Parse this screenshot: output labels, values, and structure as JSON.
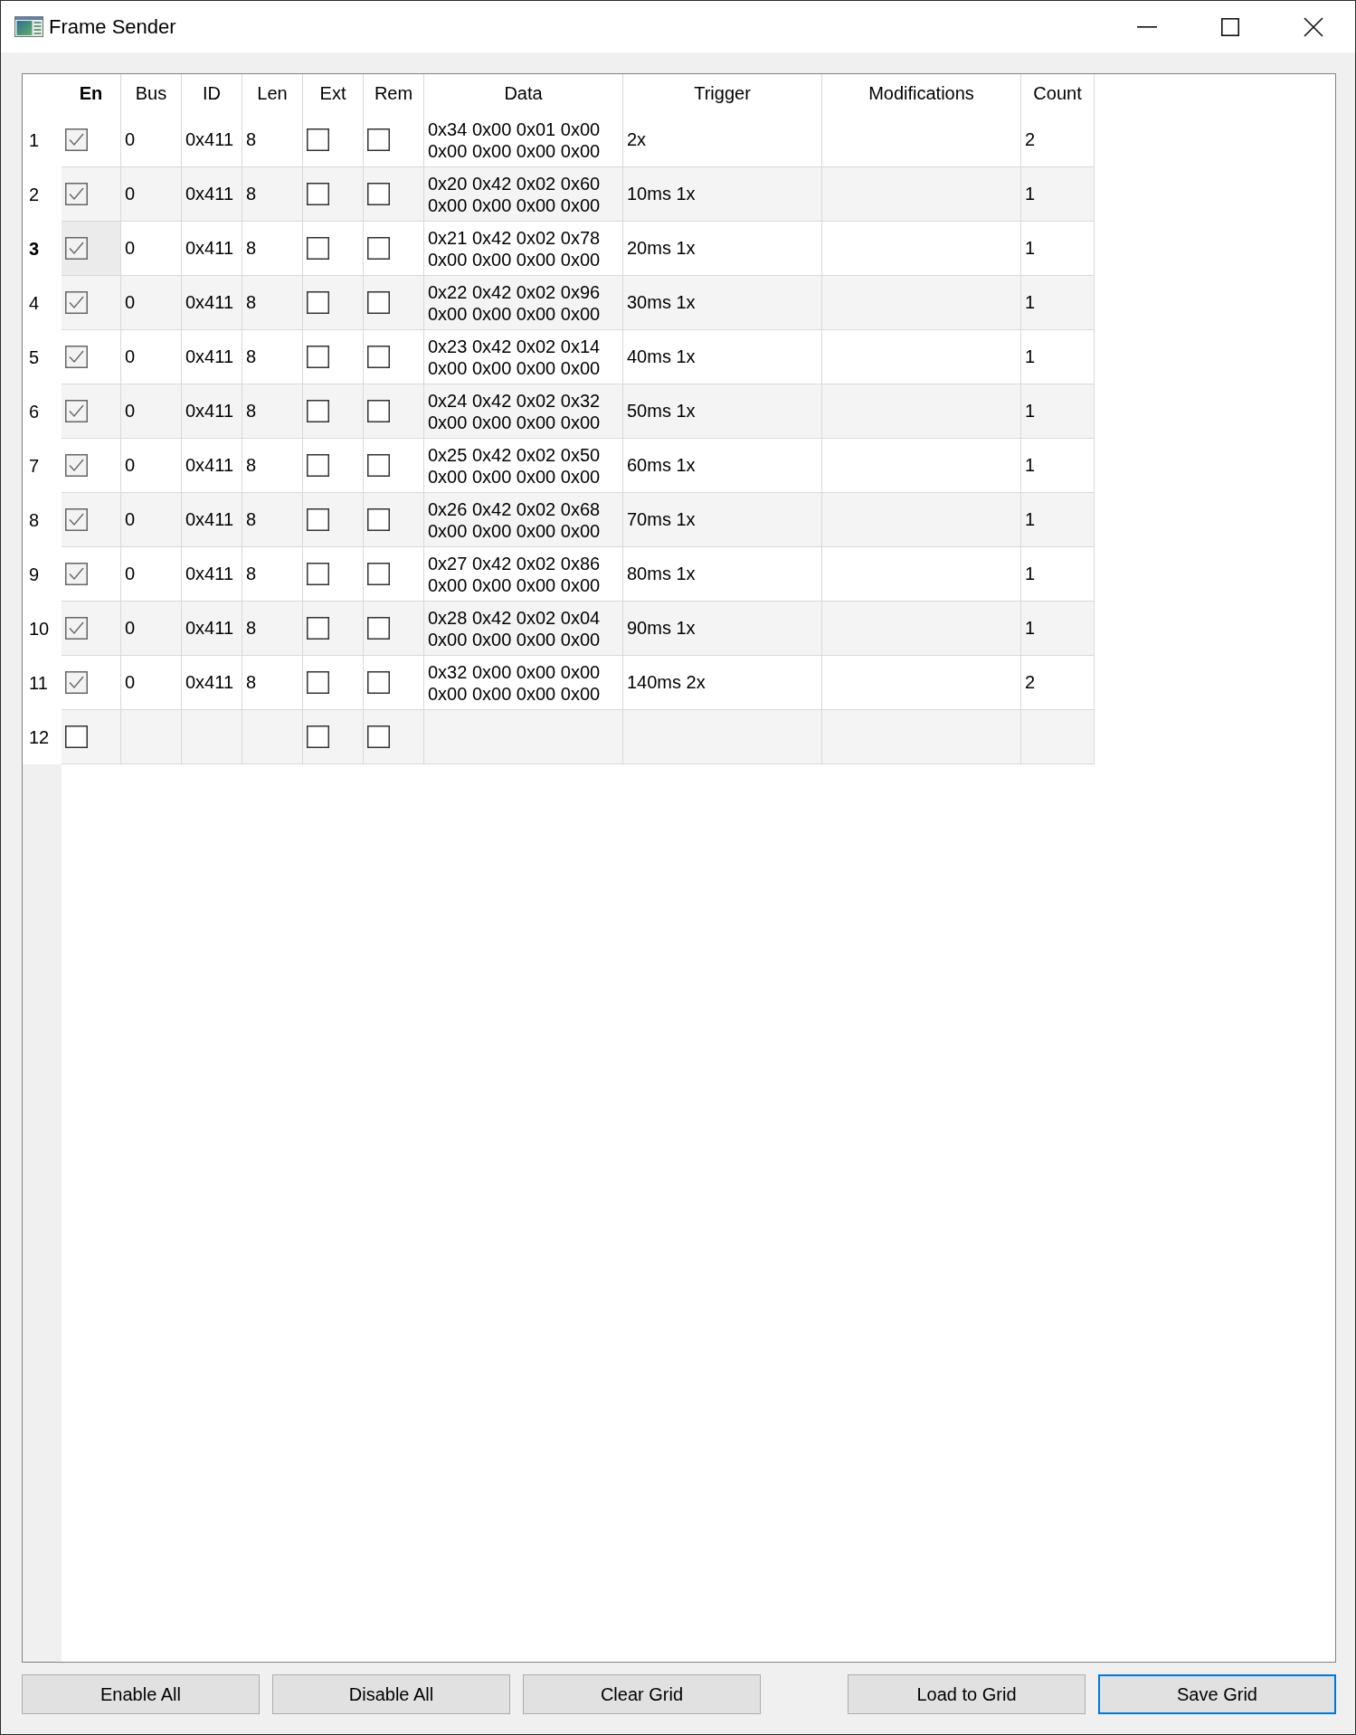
{
  "window": {
    "title": "Frame Sender"
  },
  "table": {
    "columns": [
      {
        "label": "En",
        "kind": "check",
        "current": true
      },
      {
        "label": "Bus",
        "kind": "text",
        "current": false
      },
      {
        "label": "ID",
        "kind": "text",
        "current": false
      },
      {
        "label": "Len",
        "kind": "text",
        "current": false
      },
      {
        "label": "Ext",
        "kind": "check",
        "current": false
      },
      {
        "label": "Rem",
        "kind": "check",
        "current": false
      },
      {
        "label": "Data",
        "kind": "text",
        "current": false
      },
      {
        "label": "Trigger",
        "kind": "text",
        "current": false
      },
      {
        "label": "Modifications",
        "kind": "text",
        "current": false
      },
      {
        "label": "Count",
        "kind": "text",
        "current": false
      }
    ],
    "rows": [
      {
        "number": "1",
        "current": false,
        "cells": [
          {
            "checked": true
          },
          {
            "text": "0"
          },
          {
            "text": "0x411"
          },
          {
            "text": "8"
          },
          {
            "checked": false
          },
          {
            "checked": false
          },
          {
            "text": "0x34 0x00 0x01 0x00 0x00 0x00 0x00 0x00"
          },
          {
            "text": "2x"
          },
          {},
          {
            "text": "2"
          }
        ]
      },
      {
        "number": "2",
        "current": false,
        "cells": [
          {
            "checked": true
          },
          {
            "text": "0"
          },
          {
            "text": "0x411"
          },
          {
            "text": "8"
          },
          {
            "checked": false
          },
          {
            "checked": false
          },
          {
            "text": "0x20 0x42 0x02 0x60 0x00 0x00 0x00 0x00"
          },
          {
            "text": "10ms 1x"
          },
          {},
          {
            "text": "1"
          }
        ]
      },
      {
        "number": "3",
        "current": true,
        "cells": [
          {
            "checked": true
          },
          {
            "text": "0"
          },
          {
            "text": "0x411"
          },
          {
            "text": "8"
          },
          {
            "checked": false
          },
          {
            "checked": false
          },
          {
            "text": "0x21 0x42 0x02 0x78 0x00 0x00 0x00 0x00"
          },
          {
            "text": "20ms 1x"
          },
          {},
          {
            "text": "1"
          }
        ]
      },
      {
        "number": "4",
        "current": false,
        "cells": [
          {
            "checked": true
          },
          {
            "text": "0"
          },
          {
            "text": "0x411"
          },
          {
            "text": "8"
          },
          {
            "checked": false
          },
          {
            "checked": false
          },
          {
            "text": "0x22 0x42 0x02 0x96 0x00 0x00 0x00 0x00"
          },
          {
            "text": "30ms 1x"
          },
          {},
          {
            "text": "1"
          }
        ]
      },
      {
        "number": "5",
        "current": false,
        "cells": [
          {
            "checked": true
          },
          {
            "text": "0"
          },
          {
            "text": "0x411"
          },
          {
            "text": "8"
          },
          {
            "checked": false
          },
          {
            "checked": false
          },
          {
            "text": "0x23 0x42 0x02 0x14 0x00 0x00 0x00 0x00"
          },
          {
            "text": "40ms 1x"
          },
          {},
          {
            "text": "1"
          }
        ]
      },
      {
        "number": "6",
        "current": false,
        "cells": [
          {
            "checked": true
          },
          {
            "text": "0"
          },
          {
            "text": "0x411"
          },
          {
            "text": "8"
          },
          {
            "checked": false
          },
          {
            "checked": false
          },
          {
            "text": "0x24 0x42 0x02 0x32 0x00 0x00 0x00 0x00"
          },
          {
            "text": "50ms 1x"
          },
          {},
          {
            "text": "1"
          }
        ]
      },
      {
        "number": "7",
        "current": false,
        "cells": [
          {
            "checked": true
          },
          {
            "text": "0"
          },
          {
            "text": "0x411"
          },
          {
            "text": "8"
          },
          {
            "checked": false
          },
          {
            "checked": false
          },
          {
            "text": "0x25 0x42 0x02 0x50 0x00 0x00 0x00 0x00"
          },
          {
            "text": "60ms 1x"
          },
          {},
          {
            "text": "1"
          }
        ]
      },
      {
        "number": "8",
        "current": false,
        "cells": [
          {
            "checked": true
          },
          {
            "text": "0"
          },
          {
            "text": "0x411"
          },
          {
            "text": "8"
          },
          {
            "checked": false
          },
          {
            "checked": false
          },
          {
            "text": "0x26 0x42 0x02 0x68 0x00 0x00 0x00 0x00"
          },
          {
            "text": "70ms 1x"
          },
          {},
          {
            "text": "1"
          }
        ]
      },
      {
        "number": "9",
        "current": false,
        "cells": [
          {
            "checked": true
          },
          {
            "text": "0"
          },
          {
            "text": "0x411"
          },
          {
            "text": "8"
          },
          {
            "checked": false
          },
          {
            "checked": false
          },
          {
            "text": "0x27 0x42 0x02 0x86 0x00 0x00 0x00 0x00"
          },
          {
            "text": "80ms 1x"
          },
          {},
          {
            "text": "1"
          }
        ]
      },
      {
        "number": "10",
        "current": false,
        "cells": [
          {
            "checked": true
          },
          {
            "text": "0"
          },
          {
            "text": "0x411"
          },
          {
            "text": "8"
          },
          {
            "checked": false
          },
          {
            "checked": false
          },
          {
            "text": "0x28 0x42 0x02 0x04 0x00 0x00 0x00 0x00"
          },
          {
            "text": "90ms 1x"
          },
          {},
          {
            "text": "1"
          }
        ]
      },
      {
        "number": "11",
        "current": false,
        "cells": [
          {
            "checked": true
          },
          {
            "text": "0"
          },
          {
            "text": "0x411"
          },
          {
            "text": "8"
          },
          {
            "checked": false
          },
          {
            "checked": false
          },
          {
            "text": "0x32 0x00 0x00 0x00 0x00 0x00 0x00 0x00"
          },
          {
            "text": "140ms 2x"
          },
          {},
          {
            "text": "2"
          }
        ]
      },
      {
        "number": "12",
        "current": false,
        "cells": [
          {
            "checked": false
          },
          {},
          {},
          {},
          {
            "checked": false
          },
          {
            "checked": false
          },
          {},
          {},
          {},
          {}
        ]
      }
    ]
  },
  "buttons_left": [
    {
      "label": "Enable All",
      "focused": false
    },
    {
      "label": "Disable All",
      "focused": false
    },
    {
      "label": "Clear Grid",
      "focused": false
    }
  ],
  "buttons_right": [
    {
      "label": "Load to Grid",
      "focused": false
    },
    {
      "label": "Save Grid",
      "focused": true
    }
  ]
}
